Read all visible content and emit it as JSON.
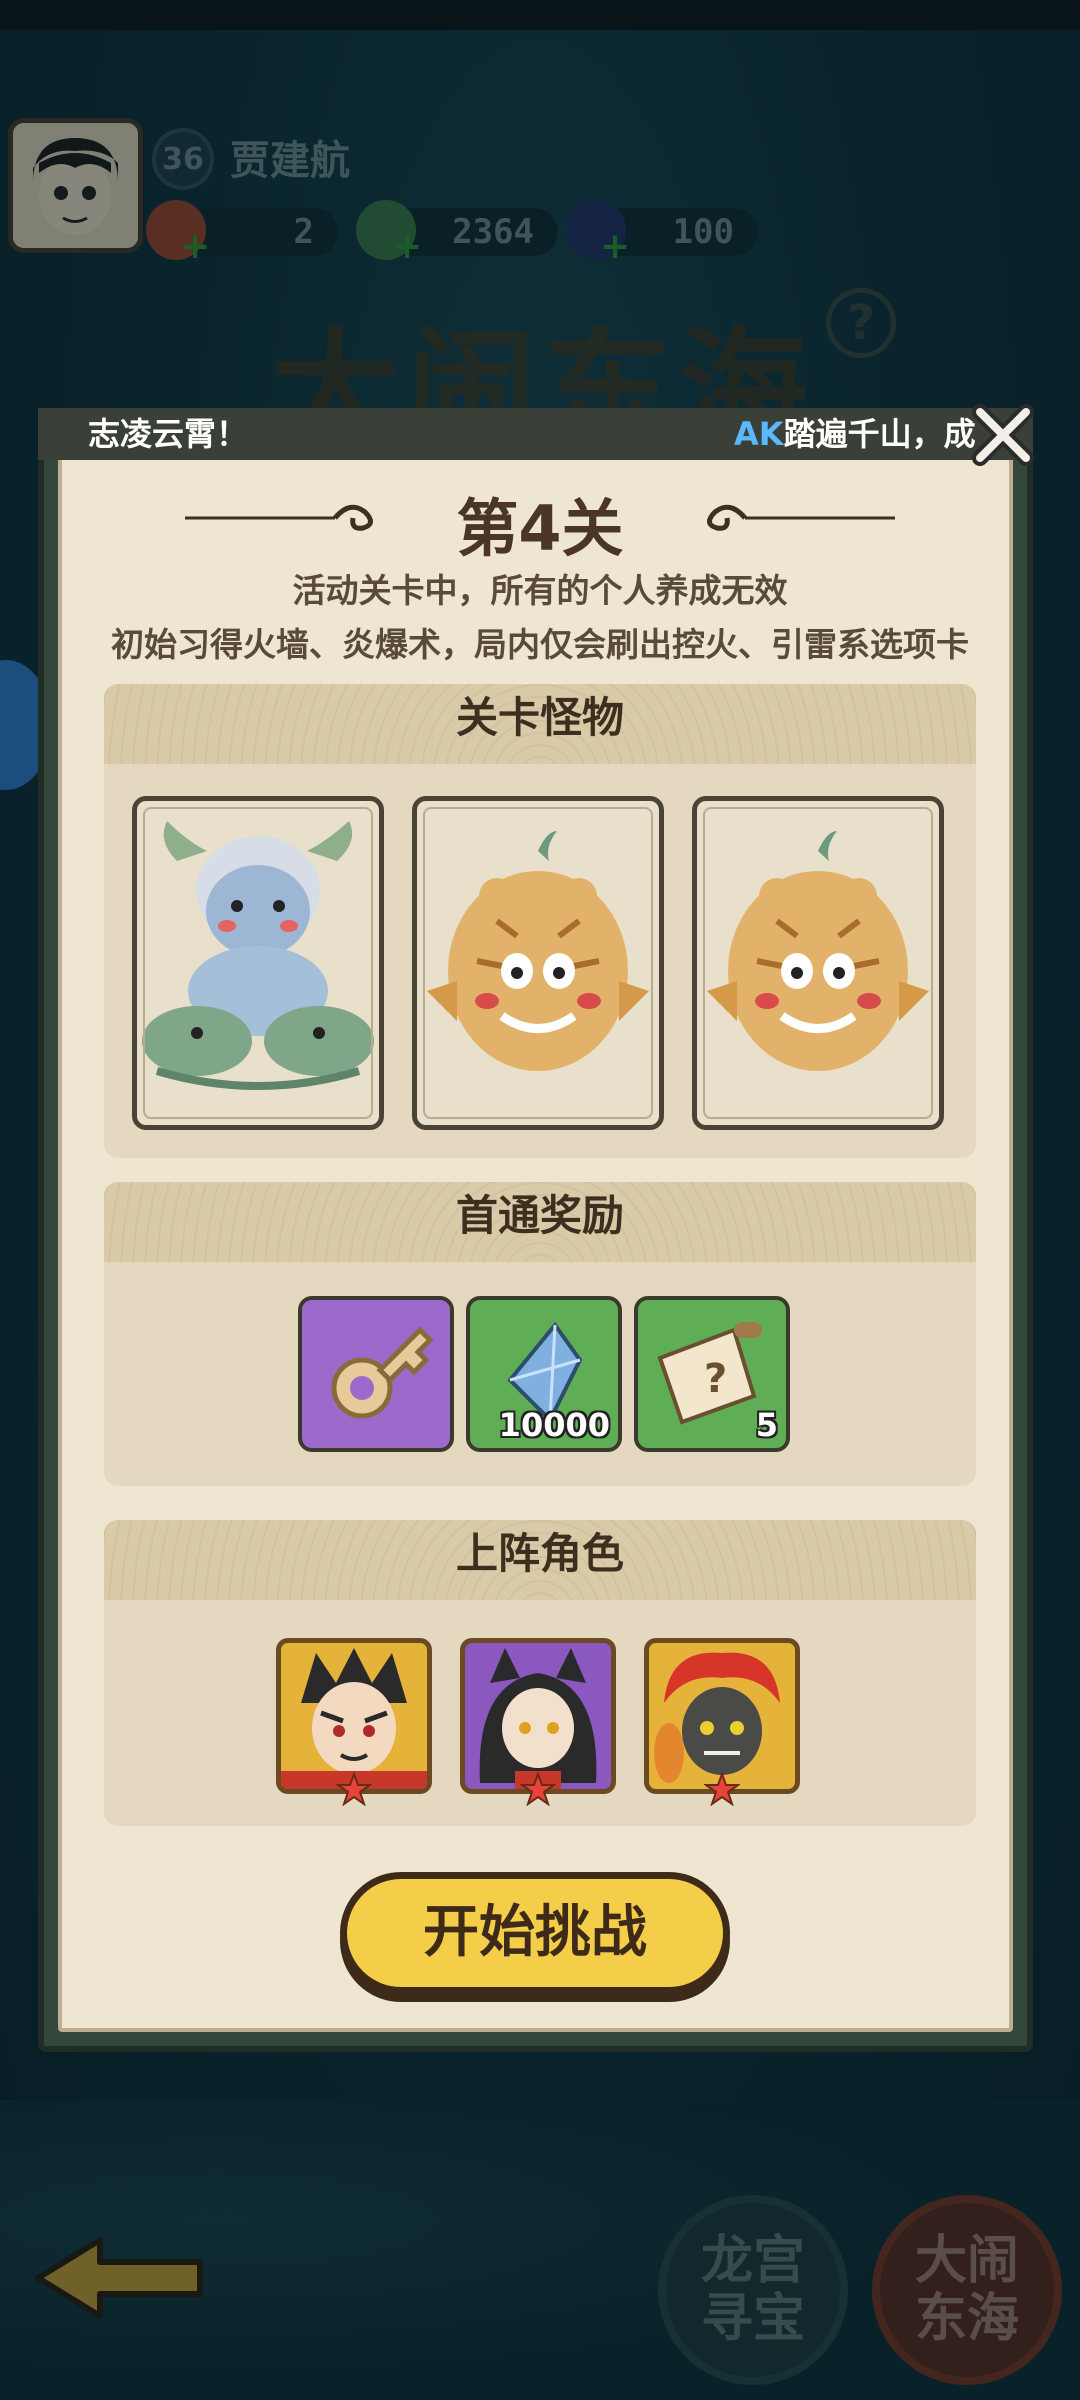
{
  "player": {
    "level": "36",
    "name": "贾建航"
  },
  "resources": [
    {
      "name": "bag",
      "value": "2"
    },
    {
      "name": "jade-dragon",
      "value": "2364"
    },
    {
      "name": "orb",
      "value": "100"
    }
  ],
  "background": {
    "title": "大闹东海",
    "help": "?"
  },
  "marquee": {
    "left_text": "志凌云霄！",
    "highlight": "AK",
    "right_text": "踏遍千山，成"
  },
  "stage": {
    "title": "第4关",
    "desc_line1": "活动关卡中，所有的个人养成无效",
    "desc_line2": "初始习得火墙、炎爆术，局内仅会刷出控火、引雷系选项卡"
  },
  "sections": {
    "monsters_title": "关卡怪物",
    "rewards_title": "首通奖励",
    "heroes_title": "上阵角色"
  },
  "monsters": [
    {
      "icon": "dragon-king-monster-icon"
    },
    {
      "icon": "tiger-monster-icon"
    },
    {
      "icon": "tiger-monster-icon"
    }
  ],
  "rewards": [
    {
      "icon": "key-icon",
      "qty": ""
    },
    {
      "icon": "crystal-icon",
      "qty": "10000"
    },
    {
      "icon": "scroll-icon",
      "qty": "5"
    }
  ],
  "heroes": [
    {
      "icon": "nezha-hero-icon"
    },
    {
      "icon": "fox-girl-hero-icon"
    },
    {
      "icon": "red-demon-hero-icon"
    }
  ],
  "start_button": "开始挑战",
  "nav": {
    "dragon_palace": "龙宫寻宝",
    "east_sea": "大闹东海"
  },
  "colors": {
    "accent": "#f4ce48",
    "modal_frame": "#33473a",
    "parchment": "#efe6d2"
  }
}
